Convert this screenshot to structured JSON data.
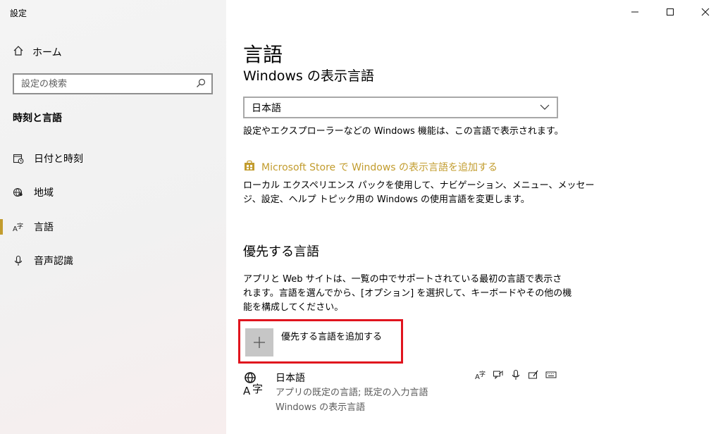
{
  "window": {
    "title": "設定"
  },
  "sidebar": {
    "home_label": "ホーム",
    "search_placeholder": "設定の検索",
    "section_heading": "時刻と言語",
    "items": [
      {
        "label": "日付と時刻",
        "icon": "calendar-clock-icon"
      },
      {
        "label": "地域",
        "icon": "globe-pin-icon"
      },
      {
        "label": "言語",
        "icon": "language-icon"
      },
      {
        "label": "音声認識",
        "icon": "microphone-icon"
      }
    ],
    "active_index": 2
  },
  "main": {
    "title": "言語",
    "display_language_title": "Windows の表示言語",
    "display_language_value": "日本語",
    "display_language_desc": "設定やエクスプローラーなどの Windows 機能は、この言語で表示されます。",
    "store_link": "Microsoft Store で Windows の表示言語を追加する",
    "local_exp_desc_line1": "ローカル エクスペリエンス パックを使用して、ナビゲーション、メニュー、メッセー",
    "local_exp_desc_line2": "ジ、設定、ヘルプ トピック用の Windows の使用言語を変更します。",
    "preferred_title": "優先する言語",
    "preferred_desc_line1": "アプリと Web サイトは、一覧の中でサポートされている最初の言語で表示さ",
    "preferred_desc_line2": "れます。言語を選んでから、[オプション] を選択して、キーボードやその他の機",
    "preferred_desc_line3": "能を構成してください。",
    "add_language_label": "優先する言語を追加する",
    "languages": [
      {
        "name": "日本語",
        "line1": "アプリの既定の言語; 既定の入力言語",
        "line2": "Windows の表示言語"
      }
    ]
  },
  "colors": {
    "accent": "#c29c2e",
    "highlight_border": "#e0141e"
  }
}
